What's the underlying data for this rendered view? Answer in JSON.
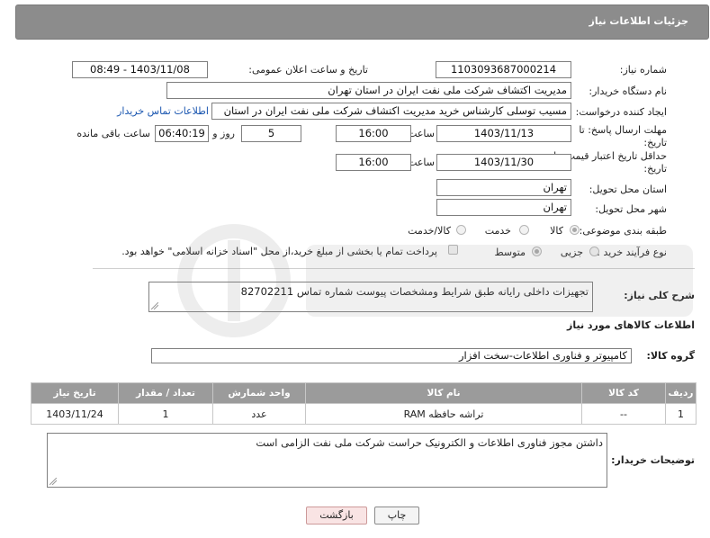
{
  "header": {
    "title": "جزئیات اطلاعات نیاز"
  },
  "form": {
    "need_number": {
      "label": "شماره نیاز:",
      "value": "1103093687000214"
    },
    "announce": {
      "label": "تاریخ و ساعت اعلان عمومی:",
      "value": "1403/11/08 - 08:49"
    },
    "buyer": {
      "label": "نام دستگاه خریدار:",
      "value": "مدیریت اکتشاف شرکت ملی نفت ایران در استان تهران"
    },
    "requester": {
      "label": "ایجاد کننده درخواست:",
      "value": "مسیب توسلی کارشناس خرید مدیریت اکتشاف شرکت ملی نفت ایران در استان",
      "contact_link": "اطلاعات تماس خریدار"
    },
    "deadline": {
      "label_line1": "مهلت ارسال پاسخ: تا",
      "label_line2": "تاریخ:",
      "date": "1403/11/13",
      "time_label": "ساعت",
      "time": "16:00",
      "days": "5",
      "days_label": "روز و",
      "remaining": "06:40:19",
      "remaining_label": "ساعت باقی مانده"
    },
    "validity": {
      "label_line1": "حداقل تاریخ اعتبار قیمت: تا",
      "label_line2": "تاریخ:",
      "date": "1403/11/30",
      "time_label": "ساعت",
      "time": "16:00"
    },
    "province": {
      "label": "استان محل تحویل:",
      "value": "تهران"
    },
    "city": {
      "label": "شهر محل تحویل:",
      "value": "تهران"
    },
    "category": {
      "label": "طبقه بندی موضوعی:",
      "options": [
        "کالا",
        "خدمت",
        "کالا/خدمت"
      ]
    },
    "process": {
      "label": "نوع فرآیند خرید :",
      "options": [
        "جزیی",
        "متوسط"
      ],
      "payment_note": "پرداخت تمام یا بخشی از مبلغ خرید،از محل \"اسناد خزانه اسلامی\" خواهد بود."
    },
    "description": {
      "label": "شرح کلی نیاز:",
      "value": "تجهیزات داخلی رایانه طبق شرایط  ومشخصات پیوست شماره تماس  82702211"
    },
    "goods_info_title": "اطلاعات کالاهای مورد نیاز",
    "goods_group": {
      "label": "گروه کالا:",
      "value": "کامپیوتر و فناوری اطلاعات-سخت افزار"
    }
  },
  "table": {
    "headers": [
      "ردیف",
      "کد کالا",
      "نام کالا",
      "واحد شمارش",
      "تعداد / مقدار",
      "تاریخ نیاز"
    ],
    "rows": [
      [
        "1",
        "--",
        "تراشه حافظه RAM",
        "عدد",
        "1",
        "1403/11/24"
      ]
    ]
  },
  "buyer_notes": {
    "label": "توضیحات خریدار:",
    "value": "داشتن مجوز فناوری اطلاعات و الکترونیک حراست  شرکت ملی نفت الزامی است"
  },
  "buttons": {
    "print": "چاپ",
    "back": "بازگشت"
  },
  "colors": {
    "header_bg": "#8c8c8c",
    "table_header_bg": "#9b9b9b",
    "back_button_bg": "#f9e4e4",
    "link": "#1a56b0"
  }
}
